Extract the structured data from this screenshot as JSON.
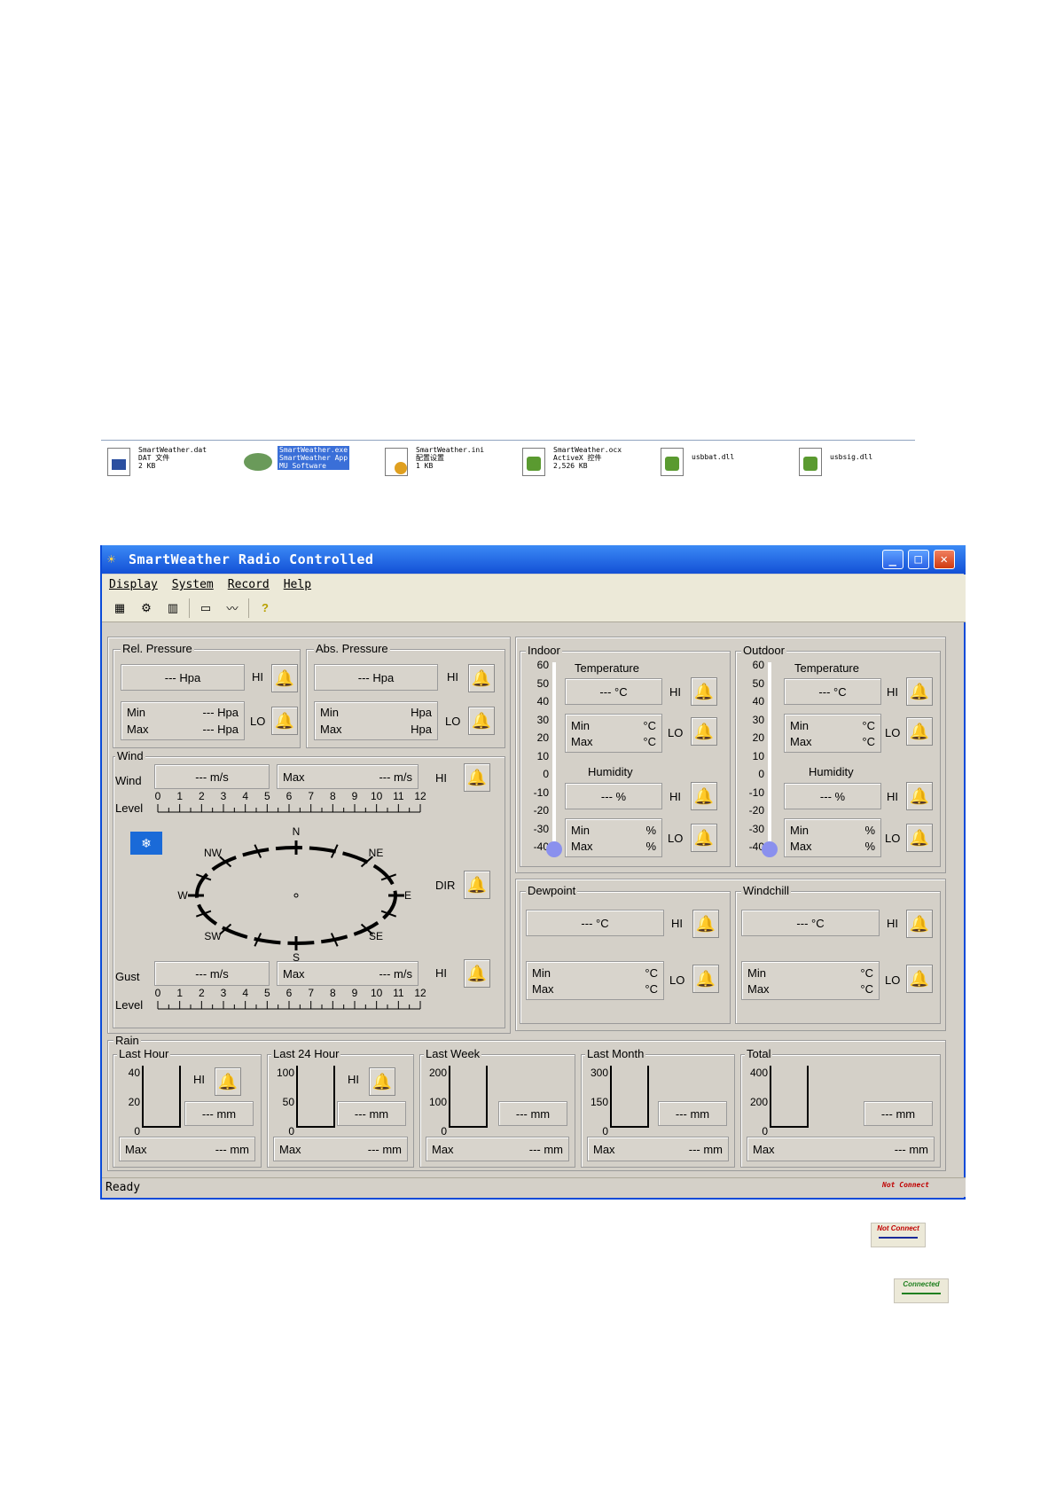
{
  "files": [
    {
      "name": "SmartWeather.dat",
      "l2": "DAT 文件",
      "l3": "2 KB",
      "icon": "calendar-file-icon"
    },
    {
      "name": "SmartWeather.exe",
      "l2": "SmartWeather App",
      "l3": "MU Software",
      "icon": "weather-app-icon"
    },
    {
      "name": "SmartWeather.ini",
      "l2": "配置设置",
      "l3": "1 KB",
      "icon": "config-file-icon"
    },
    {
      "name": "SmartWeather.ocx",
      "l2": "ActiveX 控件",
      "l3": "2,526 KB",
      "icon": "activex-file-icon"
    },
    {
      "name": "usbbat.dll",
      "l2": "",
      "l3": "",
      "icon": "dll-file-icon"
    },
    {
      "name": "usbsig.dll",
      "l2": "",
      "l3": "",
      "icon": "dll-file-icon"
    }
  ],
  "window": {
    "title": "SmartWeather Radio Controlled",
    "status": "Ready"
  },
  "menu": [
    "Display",
    "System",
    "Record",
    "Help"
  ],
  "labels": {
    "hi": "HI",
    "lo": "LO",
    "min": "Min",
    "max": "Max",
    "dir": "DIR",
    "level": "Level",
    "wind": "Wind",
    "gust": "Gust",
    "temperature": "Temperature",
    "humidity": "Humidity"
  },
  "pressure": {
    "rel_title": "Rel. Pressure",
    "abs_title": "Abs. Pressure",
    "rel_value": "--- Hpa",
    "abs_value": "--- Hpa",
    "rel_min": "--- Hpa",
    "rel_max": "--- Hpa",
    "abs_min": "Hpa",
    "abs_max": "Hpa"
  },
  "wind": {
    "title": "Wind",
    "wind_value": "--- m/s",
    "wind_max": "--- m/s",
    "gust_value": "--- m/s",
    "gust_max": "--- m/s",
    "ticks": [
      "0",
      "1",
      "2",
      "3",
      "4",
      "5",
      "6",
      "7",
      "8",
      "9",
      "10",
      "11",
      "12"
    ],
    "compass": {
      "n": "N",
      "ne": "NE",
      "e": "E",
      "se": "SE",
      "s": "S",
      "sw": "SW",
      "w": "W",
      "nw": "NW"
    }
  },
  "indoor": {
    "title": "Indoor",
    "temp": "--- °C",
    "temp_min": "°C",
    "temp_max": "°C",
    "hum": "--- %",
    "hum_min": "%",
    "hum_max": "%"
  },
  "outdoor": {
    "title": "Outdoor",
    "temp": "--- °C",
    "temp_min": "°C",
    "temp_max": "°C",
    "hum": "--- %",
    "hum_min": "%",
    "hum_max": "%"
  },
  "scale": [
    "60",
    "50",
    "40",
    "30",
    "20",
    "10",
    "0",
    "-10",
    "-20",
    "-30",
    "-40"
  ],
  "dewpoint": {
    "title": "Dewpoint",
    "value": "--- °C",
    "min": "°C",
    "max": "°C"
  },
  "windchill": {
    "title": "Windchill",
    "value": "--- °C",
    "min": "°C",
    "max": "°C"
  },
  "rain": {
    "title": "Rain",
    "panels": [
      {
        "title": "Last Hour",
        "ticks": [
          "40",
          "20",
          "0"
        ],
        "value": "--- mm",
        "max": "--- mm"
      },
      {
        "title": "Last 24 Hour",
        "ticks": [
          "100",
          "50",
          "0"
        ],
        "value": "--- mm",
        "max": "--- mm"
      },
      {
        "title": "Last Week",
        "ticks": [
          "200",
          "100",
          "0"
        ],
        "value": "--- mm",
        "max": "--- mm"
      },
      {
        "title": "Last Month",
        "ticks": [
          "300",
          "150",
          "0"
        ],
        "value": "--- mm",
        "max": "--- mm"
      },
      {
        "title": "Total",
        "ticks": [
          "400",
          "200",
          "0"
        ],
        "value": "--- mm",
        "max": "--- mm"
      }
    ]
  },
  "logos": {
    "connect": "Not Connect",
    "connected": "Connected"
  },
  "colors": {
    "title_bar": "#1c5be0",
    "face": "#d4d0c8",
    "bulb": "#8a90ee",
    "connect": "#c00000",
    "connected": "#208020"
  }
}
